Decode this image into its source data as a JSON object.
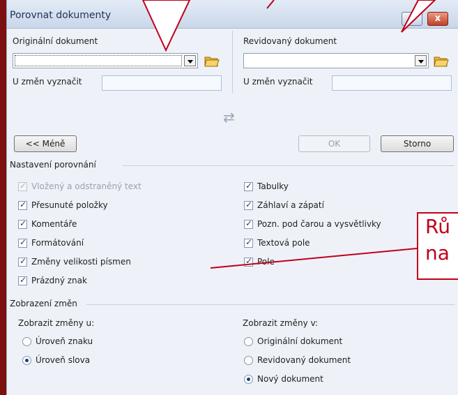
{
  "window": {
    "title": "Porovnat dokumenty",
    "close_glyph": "x"
  },
  "original": {
    "label": "Originální dokument",
    "value": "",
    "mark_label": "U změn vyznačit",
    "mark_value": ""
  },
  "revised": {
    "label": "Revidovaný dokument",
    "value": "",
    "mark_label": "U změn vyznačit",
    "mark_value": ""
  },
  "swap_glyph": "⇄",
  "buttons": {
    "less": "<< Méně",
    "ok": "OK",
    "cancel": "Storno"
  },
  "comparison_settings": {
    "heading": "Nastavení porovnání",
    "left": [
      {
        "label": "Vložený a odstraněný text",
        "checked": true,
        "disabled": true
      },
      {
        "label": "Přesunuté položky",
        "checked": true,
        "disabled": false
      },
      {
        "label": "Komentáře",
        "checked": true,
        "disabled": false
      },
      {
        "label": "Formátování",
        "checked": true,
        "disabled": false
      },
      {
        "label": "Změny velikosti písmen",
        "checked": true,
        "disabled": false
      },
      {
        "label": "Prázdný znak",
        "checked": true,
        "disabled": false
      }
    ],
    "right": [
      {
        "label": "Tabulky",
        "checked": true
      },
      {
        "label": "Záhlaví a zápatí",
        "checked": true
      },
      {
        "label": "Pozn. pod čarou a vysvětlivky",
        "checked": true
      },
      {
        "label": "Textová pole",
        "checked": true
      },
      {
        "label": "Pole",
        "checked": true
      }
    ]
  },
  "show_changes": {
    "heading": "Zobrazení změn",
    "level_heading": "Zobrazit změny u:",
    "level_options": [
      {
        "label": "Úroveň znaku",
        "selected": false
      },
      {
        "label": "Úroveň slova",
        "selected": true
      }
    ],
    "target_heading": "Zobrazit změny v:",
    "target_options": [
      {
        "label": "Originální dokument",
        "selected": false
      },
      {
        "label": "Revidovaný dokument",
        "selected": false
      },
      {
        "label": "Nový dokument",
        "selected": true
      }
    ]
  },
  "callout": {
    "line1": "Rů",
    "line2": "na"
  },
  "colors": {
    "annotation": "#c0001a",
    "background": "#7a1010",
    "dialog": "#eef2f8"
  }
}
